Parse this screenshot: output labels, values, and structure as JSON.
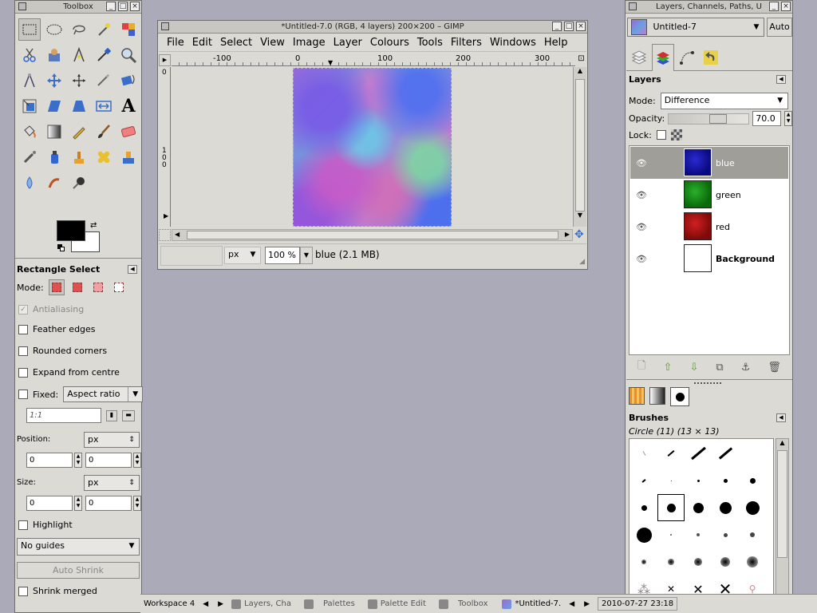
{
  "toolbox": {
    "title": "Toolbox",
    "tool_options_title": "Rectangle Select",
    "mode_label": "Mode:",
    "antialiasing": "Antialiasing",
    "feather_edges": "Feather edges",
    "rounded_corners": "Rounded corners",
    "expand_from_centre": "Expand from centre",
    "fixed_label": "Fixed:",
    "fixed_option": "Aspect ratio",
    "ratio_value": "1:1",
    "position_label": "Position:",
    "position_unit": "px",
    "position_x": "0",
    "position_y": "0",
    "size_label": "Size:",
    "size_unit": "px",
    "size_w": "0",
    "size_h": "0",
    "highlight": "Highlight",
    "guides": "No guides",
    "auto_shrink": "Auto Shrink",
    "shrink_merged": "Shrink merged"
  },
  "image_window": {
    "title": "*Untitled-7.0 (RGB, 4 layers) 200×200 – GIMP",
    "menus": [
      "File",
      "Edit",
      "Select",
      "View",
      "Image",
      "Layer",
      "Colours",
      "Tools",
      "Filters",
      "Windows",
      "Help"
    ],
    "ruler_labels": [
      "-100",
      "0",
      "100",
      "200",
      "300"
    ],
    "vruler_labels": [
      "0",
      "1",
      "0",
      "0"
    ],
    "unit": "px",
    "zoom": "100 %",
    "status": "blue (2.1 MB)"
  },
  "layers_dock": {
    "title": "Layers, Channels, Paths, U",
    "image_select": "Untitled-7",
    "auto_label": "Auto",
    "panel_title": "Layers",
    "mode_label": "Mode:",
    "mode_value": "Difference",
    "opacity_label": "Opacity:",
    "opacity_value": "70.0",
    "lock_label": "Lock:",
    "layers": [
      {
        "name": "blue",
        "color": "#1a1aa8"
      },
      {
        "name": "green",
        "color": "#1c8a1c"
      },
      {
        "name": "red",
        "color": "#a81414"
      },
      {
        "name": "Background",
        "color": "#ffffff"
      }
    ],
    "brushes_title": "Brushes",
    "brush_name": "Circle (11) (13 × 13)"
  },
  "taskbar": {
    "workspace": "Workspace 4",
    "tasks": [
      "Layers, Cha",
      "Palettes",
      "Palette Edit",
      "Toolbox",
      "*Untitled-7."
    ],
    "clock": "2010-07-27 23:18"
  },
  "colors": {
    "desktop": "#abaab8",
    "window_bg": "#dcdad5",
    "selected_layer": "#a09e99",
    "canvas_bg": "#dcdad5"
  }
}
